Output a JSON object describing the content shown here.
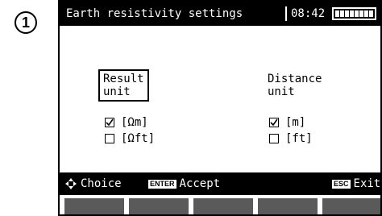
{
  "step_number": "1",
  "title": "Earth resistivity settings",
  "time": "08:42",
  "battery": {
    "level": 1.0,
    "cells": 8
  },
  "result_unit": {
    "label_line1": "Result",
    "label_line2": "unit",
    "options": [
      {
        "label": "[Ωm]",
        "checked": true
      },
      {
        "label": "[Ωft]",
        "checked": false
      }
    ]
  },
  "distance_unit": {
    "label_line1": "Distance",
    "label_line2": "unit",
    "options": [
      {
        "label": "[m]",
        "checked": true
      },
      {
        "label": "[ft]",
        "checked": false
      }
    ]
  },
  "footer": {
    "choice_label": "Choice",
    "enter_key": "ENTER",
    "accept_label": "Accept",
    "esc_key": "ESC",
    "exit_label": "Exit"
  },
  "colors": {
    "screen_bg": "#ffffff",
    "bar_bg": "#000000",
    "softkey": "#5a5a5a"
  }
}
